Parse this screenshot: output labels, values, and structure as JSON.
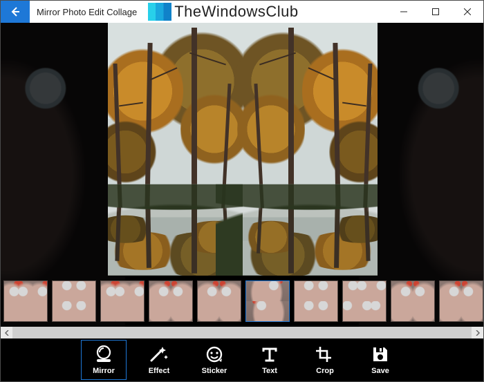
{
  "window": {
    "title": "Mirror Photo Edit Collage",
    "minimize": "–",
    "maximize": "▫",
    "close": "✕"
  },
  "brand": {
    "name": "TheWindowsClub"
  },
  "thumbnails": {
    "selected_index": 5,
    "items": [
      {
        "layout": "3x1",
        "cells": 3
      },
      {
        "layout": "2x2",
        "cells": 4
      },
      {
        "layout": "3x1",
        "cells": 3
      },
      {
        "layout": "2x1",
        "cells": 2
      },
      {
        "layout": "2x1",
        "cells": 2
      },
      {
        "layout": "1x2",
        "cells": 2
      },
      {
        "layout": "2x2",
        "cells": 4
      },
      {
        "layout": "3x2",
        "cells": 6
      },
      {
        "layout": "2x1",
        "cells": 2
      },
      {
        "layout": "2x1",
        "cells": 2
      }
    ]
  },
  "toolbar": {
    "selected_index": 0,
    "items": [
      {
        "icon": "mirror-icon",
        "label": "Mirror"
      },
      {
        "icon": "effect-icon",
        "label": "Effect"
      },
      {
        "icon": "sticker-icon",
        "label": "Sticker"
      },
      {
        "icon": "text-icon",
        "label": "Text"
      },
      {
        "icon": "crop-icon",
        "label": "Crop"
      },
      {
        "icon": "save-icon",
        "label": "Save"
      }
    ]
  },
  "colors": {
    "accent": "#1e78d7"
  }
}
